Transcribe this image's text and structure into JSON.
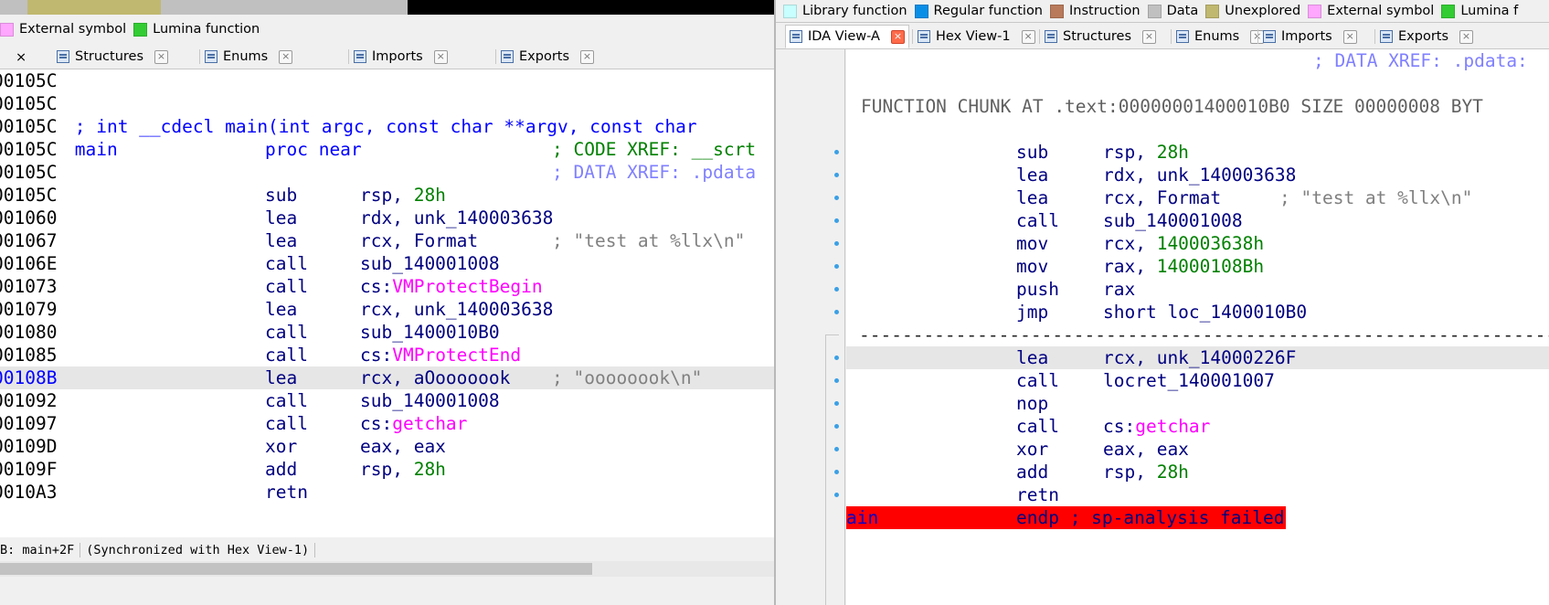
{
  "colors": {
    "library": "#c8ffff",
    "regular": "#0a8fe6",
    "instruction": "#b87a5a",
    "data": "#c0c0c0",
    "unexplored": "#c0b870",
    "external": "#ffa6ff",
    "lumina": "#33cc33",
    "highlight_line": "#e6e6e6",
    "error_line": "#ff0000"
  },
  "left": {
    "legend": [
      {
        "label": "External symbol",
        "color": "#ffa6ff"
      },
      {
        "label": "Lumina function",
        "color": "#33cc33"
      }
    ],
    "tabs": [
      {
        "label": "Structures",
        "icon": "structures-icon"
      },
      {
        "label": "Enums",
        "icon": "enums-icon"
      },
      {
        "label": "Imports",
        "icon": "imports-icon"
      },
      {
        "label": "Exports",
        "icon": "exports-icon"
      }
    ],
    "lines": [
      {
        "addr": "00105C",
        "text": ""
      },
      {
        "addr": "00105C",
        "text": ""
      },
      {
        "addr": "00105C",
        "text": " ; int __cdecl main(int argc, const char **argv, const char"
      },
      {
        "addr": "00105C",
        "label": " main",
        "op": "proc near",
        "comment": "; CODE XREF: __scrt"
      },
      {
        "addr": "00105C",
        "comment2": "; DATA XREF: .pdata"
      },
      {
        "addr": "00105C",
        "mnem": "sub",
        "arg1": "rsp, ",
        "num": "28h"
      },
      {
        "addr": "001060",
        "mnem": "lea",
        "arg1": "rdx, unk_140003638"
      },
      {
        "addr": "001067",
        "mnem": "lea",
        "arg1": "rcx, Format",
        "cmt": "; \"test at %llx\\n\""
      },
      {
        "addr": "00106E",
        "mnem": "call",
        "arg1": "sub_140001008"
      },
      {
        "addr": "001073",
        "mnem": "call",
        "arg1": "cs:",
        "imp": "VMProtectBegin"
      },
      {
        "addr": "001079",
        "mnem": "lea",
        "arg1": "rcx, unk_140003638"
      },
      {
        "addr": "001080",
        "mnem": "call",
        "arg1": "sub_1400010B0"
      },
      {
        "addr": "001085",
        "mnem": "call",
        "arg1": "cs:",
        "imp": "VMProtectEnd"
      },
      {
        "addr": "00108B",
        "mnem": "lea",
        "arg1": "rcx, aOooooook",
        "cmt": "; \"oooooook\\n\"",
        "hl": true
      },
      {
        "addr": "001092",
        "mnem": "call",
        "arg1": "sub_140001008"
      },
      {
        "addr": "001097",
        "mnem": "call",
        "arg1": "cs:",
        "imp": "getchar"
      },
      {
        "addr": "00109D",
        "mnem": "xor",
        "arg1": "eax, eax"
      },
      {
        "addr": "00109F",
        "mnem": "add",
        "arg1": "rsp, ",
        "num": "28h"
      },
      {
        "addr": "0010A3",
        "mnem": "retn",
        "arg1": ""
      }
    ],
    "status": "B: main+2F",
    "status_sync": "(Synchronized with Hex View-1)"
  },
  "right": {
    "legend": [
      {
        "label": "Library function",
        "color": "#c8ffff"
      },
      {
        "label": "Regular function",
        "color": "#0a8fe6"
      },
      {
        "label": "Instruction",
        "color": "#b87a5a"
      },
      {
        "label": "Data",
        "color": "#c0c0c0"
      },
      {
        "label": "Unexplored",
        "color": "#c0b870"
      },
      {
        "label": "External symbol",
        "color": "#ffa6ff"
      },
      {
        "label": "Lumina f",
        "color": "#33cc33"
      }
    ],
    "tabs": [
      {
        "label": "IDA View-A",
        "icon": "ida-view-icon",
        "active": true
      },
      {
        "label": "Hex View-1",
        "icon": "hex-view-icon"
      },
      {
        "label": "Structures",
        "icon": "structures-icon"
      },
      {
        "label": "Enums",
        "icon": "enums-icon"
      },
      {
        "label": "Imports",
        "icon": "imports-icon"
      },
      {
        "label": "Exports",
        "icon": "exports-icon"
      }
    ],
    "top_comment": "; DATA XREF: .pdata:",
    "chunk_header": "FUNCTION CHUNK AT .text:00000001400010B0 SIZE 00000008 BYT",
    "block1": [
      {
        "mnem": "sub",
        "arg1": "rsp, ",
        "num": "28h"
      },
      {
        "mnem": "lea",
        "arg1": "rdx, unk_140003638"
      },
      {
        "mnem": "lea",
        "arg1": "rcx, Format",
        "cmt": "; \"test at %llx\\n\""
      },
      {
        "mnem": "call",
        "arg1": "sub_140001008"
      },
      {
        "mnem": "mov",
        "arg1": "rcx, ",
        "num": "140003638h"
      },
      {
        "mnem": "mov",
        "arg1": "rax, ",
        "num": "14000108Bh"
      },
      {
        "mnem": "push",
        "arg1": "rax"
      },
      {
        "mnem": "jmp",
        "arg1": "short loc_1400010B0"
      }
    ],
    "block2": [
      {
        "mnem": "lea",
        "arg1": "rcx, unk_14000226F",
        "hl": true
      },
      {
        "mnem": "call",
        "arg1": "locret_140001007"
      },
      {
        "mnem": "nop",
        "arg1": ""
      },
      {
        "mnem": "call",
        "arg1": "cs:",
        "imp": "getchar"
      },
      {
        "mnem": "xor",
        "arg1": "eax, eax"
      },
      {
        "mnem": "add",
        "arg1": "rsp, ",
        "num": "28h"
      },
      {
        "mnem": "retn",
        "arg1": ""
      }
    ],
    "endp_label": "ain",
    "endp_text": "endp ; sp-analysis failed"
  }
}
